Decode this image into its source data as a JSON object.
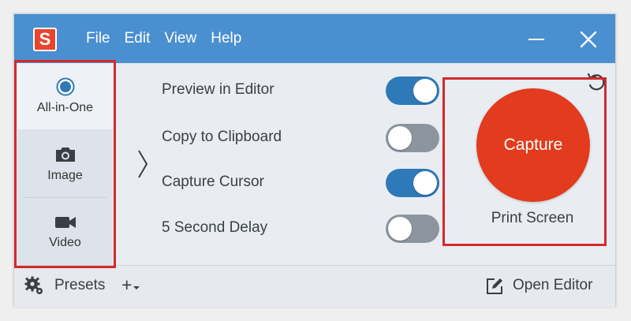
{
  "app": {
    "logo_letter": "S"
  },
  "menu": [
    "File",
    "Edit",
    "View",
    "Help"
  ],
  "sidebar": {
    "items": [
      {
        "label": "All-in-One",
        "icon": "radio-selected-icon",
        "active": true
      },
      {
        "label": "Image",
        "icon": "camera-icon",
        "active": false
      },
      {
        "label": "Video",
        "icon": "video-camera-icon",
        "active": false
      }
    ]
  },
  "options": [
    {
      "label": "Preview in Editor",
      "enabled": true
    },
    {
      "label": "Copy to Clipboard",
      "enabled": false
    },
    {
      "label": "Capture Cursor",
      "enabled": true
    },
    {
      "label": "5 Second Delay",
      "enabled": false
    }
  ],
  "capture": {
    "button_label": "Capture",
    "hotkey": "Print Screen"
  },
  "footer": {
    "presets_label": "Presets",
    "add_label": "+",
    "open_editor_label": "Open Editor"
  },
  "colors": {
    "titlebar": "#4a8fd0",
    "capture": "#e23b1d",
    "toggle_on": "#2e79b8",
    "toggle_off": "#8c959e",
    "highlight": "#d22a2a"
  }
}
